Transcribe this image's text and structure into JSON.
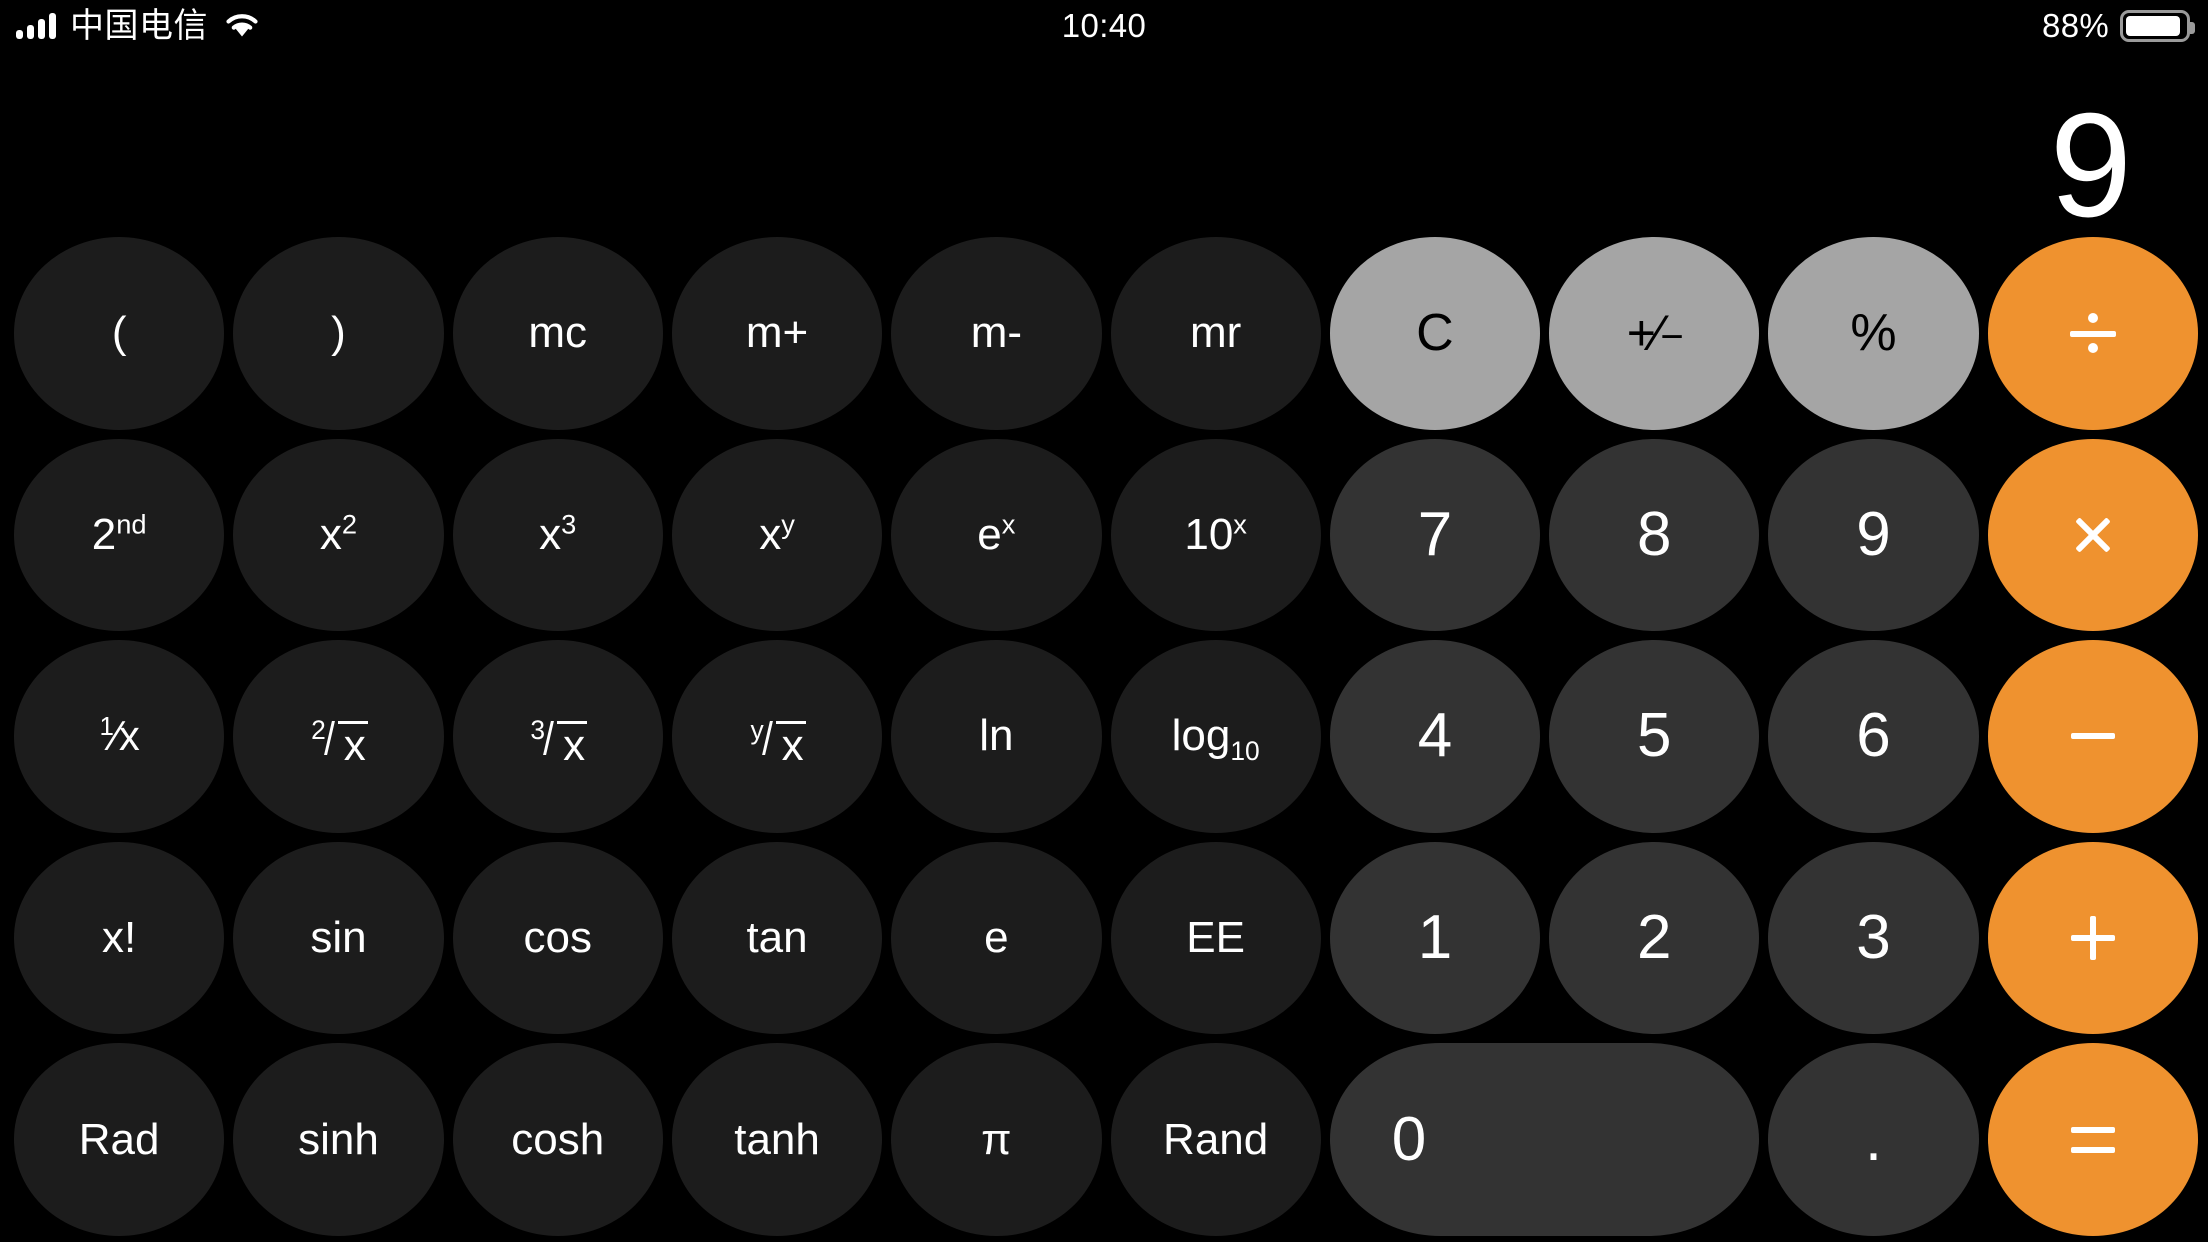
{
  "status_bar": {
    "carrier": "中国电信",
    "signal_icon": "cellular-signal-icon",
    "wifi_icon": "wifi-icon",
    "time": "10:40",
    "battery_percent": "88%",
    "battery_icon": "battery-icon",
    "battery_level": 88
  },
  "display": {
    "value": "9"
  },
  "colors": {
    "background": "#000000",
    "function_key": "#1c1c1c",
    "number_key": "#333333",
    "utility_key": "#a5a5a5",
    "operator_key": "#ef922f",
    "text_light": "#ffffff",
    "text_dark": "#000000"
  },
  "keypad": {
    "rows": [
      {
        "keys": [
          {
            "name": "open-paren-key",
            "label": "(",
            "kind": "fn"
          },
          {
            "name": "close-paren-key",
            "label": ")",
            "kind": "fn"
          },
          {
            "name": "memory-clear-key",
            "label": "mc",
            "kind": "fn"
          },
          {
            "name": "memory-add-key",
            "label": "m+",
            "kind": "fn"
          },
          {
            "name": "memory-sub-key",
            "label": "m-",
            "kind": "fn"
          },
          {
            "name": "memory-recall-key",
            "label": "mr",
            "kind": "fn"
          },
          {
            "name": "clear-key",
            "label": "C",
            "kind": "util"
          },
          {
            "name": "sign-toggle-key",
            "label": "+/-",
            "kind": "util"
          },
          {
            "name": "percent-key",
            "label": "%",
            "kind": "util"
          },
          {
            "name": "divide-key",
            "label": "÷",
            "kind": "op"
          }
        ]
      },
      {
        "keys": [
          {
            "name": "second-function-key",
            "label": "2nd",
            "kind": "fn"
          },
          {
            "name": "square-key",
            "label": "x2",
            "kind": "fn"
          },
          {
            "name": "cube-key",
            "label": "x3",
            "kind": "fn"
          },
          {
            "name": "power-xy-key",
            "label": "xy",
            "kind": "fn"
          },
          {
            "name": "exp-e-key",
            "label": "ex",
            "kind": "fn"
          },
          {
            "name": "exp-ten-key",
            "label": "10x",
            "kind": "fn"
          },
          {
            "name": "digit-7-key",
            "label": "7",
            "kind": "num"
          },
          {
            "name": "digit-8-key",
            "label": "8",
            "kind": "num"
          },
          {
            "name": "digit-9-key",
            "label": "9",
            "kind": "num"
          },
          {
            "name": "multiply-key",
            "label": "×",
            "kind": "op"
          }
        ]
      },
      {
        "keys": [
          {
            "name": "reciprocal-key",
            "label": "1/x",
            "kind": "fn"
          },
          {
            "name": "square-root-key",
            "label": "2√x",
            "kind": "fn"
          },
          {
            "name": "cube-root-key",
            "label": "3√x",
            "kind": "fn"
          },
          {
            "name": "nth-root-key",
            "label": "y√x",
            "kind": "fn"
          },
          {
            "name": "natural-log-key",
            "label": "ln",
            "kind": "fn"
          },
          {
            "name": "log-base-10-key",
            "label": "log10",
            "kind": "fn"
          },
          {
            "name": "digit-4-key",
            "label": "4",
            "kind": "num"
          },
          {
            "name": "digit-5-key",
            "label": "5",
            "kind": "num"
          },
          {
            "name": "digit-6-key",
            "label": "6",
            "kind": "num"
          },
          {
            "name": "subtract-key",
            "label": "−",
            "kind": "op"
          }
        ]
      },
      {
        "keys": [
          {
            "name": "factorial-key",
            "label": "x!",
            "kind": "fn"
          },
          {
            "name": "sin-key",
            "label": "sin",
            "kind": "fn"
          },
          {
            "name": "cos-key",
            "label": "cos",
            "kind": "fn"
          },
          {
            "name": "tan-key",
            "label": "tan",
            "kind": "fn"
          },
          {
            "name": "euler-e-key",
            "label": "e",
            "kind": "fn"
          },
          {
            "name": "ee-key",
            "label": "EE",
            "kind": "fn"
          },
          {
            "name": "digit-1-key",
            "label": "1",
            "kind": "num"
          },
          {
            "name": "digit-2-key",
            "label": "2",
            "kind": "num"
          },
          {
            "name": "digit-3-key",
            "label": "3",
            "kind": "num"
          },
          {
            "name": "add-key",
            "label": "+",
            "kind": "op"
          }
        ]
      },
      {
        "keys": [
          {
            "name": "radian-mode-key",
            "label": "Rad",
            "kind": "fn"
          },
          {
            "name": "sinh-key",
            "label": "sinh",
            "kind": "fn"
          },
          {
            "name": "cosh-key",
            "label": "cosh",
            "kind": "fn"
          },
          {
            "name": "tanh-key",
            "label": "tanh",
            "kind": "fn"
          },
          {
            "name": "pi-key",
            "label": "π",
            "kind": "fn"
          },
          {
            "name": "random-key",
            "label": "Rand",
            "kind": "fn"
          },
          {
            "name": "digit-0-key",
            "label": "0",
            "kind": "num wide"
          },
          {
            "name": "decimal-point-key",
            "label": ".",
            "kind": "num"
          },
          {
            "name": "equals-key",
            "label": "=",
            "kind": "op"
          }
        ]
      }
    ]
  }
}
